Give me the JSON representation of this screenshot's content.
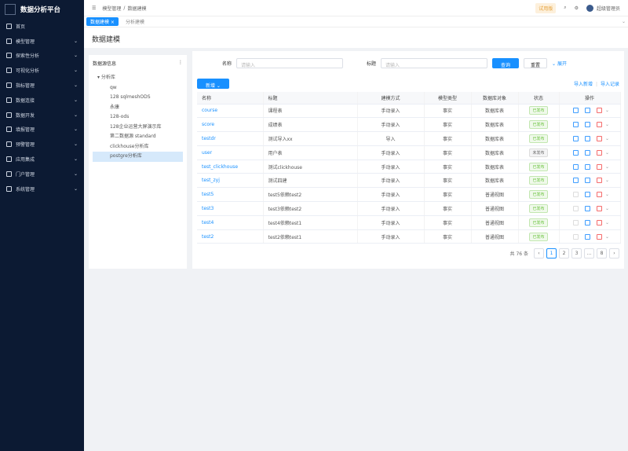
{
  "app": {
    "title": "数据分析平台"
  },
  "sidebar": {
    "items": [
      {
        "label": "首页",
        "icon": "home-icon",
        "expand": false
      },
      {
        "label": "模型管理",
        "icon": "bulb-icon",
        "expand": true
      },
      {
        "label": "探索性分析",
        "icon": "chart-icon",
        "expand": true
      },
      {
        "label": "可视化分析",
        "icon": "monitor-icon",
        "expand": true
      },
      {
        "label": "指标管理",
        "icon": "book-icon",
        "expand": true
      },
      {
        "label": "数据连接",
        "icon": "link-icon",
        "expand": true
      },
      {
        "label": "数据开发",
        "icon": "calendar-icon",
        "expand": true
      },
      {
        "label": "填报管理",
        "icon": "form-icon",
        "expand": true
      },
      {
        "label": "预警管理",
        "icon": "alert-icon",
        "expand": true
      },
      {
        "label": "应用集成",
        "icon": "app-icon",
        "expand": true
      },
      {
        "label": "门户管理",
        "icon": "portal-icon",
        "expand": true
      },
      {
        "label": "系统管理",
        "icon": "gear-icon",
        "expand": true
      }
    ]
  },
  "header": {
    "breadcrumb": [
      "模型管理",
      "数据建模"
    ],
    "trial": "试用版",
    "user": "超级管理员"
  },
  "tabs": [
    {
      "label": "数据建模 ×",
      "active": true
    },
    {
      "label": "分析建模",
      "active": false
    }
  ],
  "page_title": "数据建模",
  "tree": {
    "title": "数据源信息",
    "root": "分析库",
    "children": [
      "qw",
      "128 sqlmeshODS",
      "永康",
      "128-ods",
      "128企业运营大屏演示库",
      "第二数据源 standard",
      "clickhouse分析库",
      "postgre分析库"
    ],
    "selected": 7
  },
  "filters": {
    "name_label": "名称",
    "name_placeholder": "请输入",
    "title_label": "标题",
    "title_placeholder": "请输入",
    "search": "查询",
    "reset": "重置",
    "expand": "展开"
  },
  "toolbar": {
    "add": "新增 ⌄",
    "import_model": "导入新增",
    "import_record": "导入记录"
  },
  "table": {
    "headers": [
      "名称",
      "标题",
      "建模方式",
      "模型类型",
      "数据库对象",
      "状态",
      "操作"
    ],
    "rows": [
      [
        "course",
        "课程表",
        "手动录入",
        "事实",
        "数据库表",
        "已发布"
      ],
      [
        "score",
        "成绩表",
        "手动录入",
        "事实",
        "数据库表",
        "已发布"
      ],
      [
        "testdr",
        "测试导入xx",
        "导入",
        "事实",
        "数据库表",
        "已发布"
      ],
      [
        "user",
        "用户表",
        "手动录入",
        "事实",
        "数据库表",
        "未发布"
      ],
      [
        "test_clickhouse",
        "测试clickhouse",
        "手动录入",
        "事实",
        "数据库表",
        "已发布"
      ],
      [
        "test_zyj",
        "测试四建",
        "手动录入",
        "事实",
        "数据库表",
        "已发布"
      ],
      [
        "test5",
        "test5依赖test2",
        "手动录入",
        "事实",
        "普通视图",
        "已发布"
      ],
      [
        "test3",
        "test3依赖test2",
        "手动录入",
        "事实",
        "普通视图",
        "已发布"
      ],
      [
        "test4",
        "test4依赖test1",
        "手动录入",
        "事实",
        "普通视图",
        "已发布"
      ],
      [
        "test2",
        "test2依赖test1",
        "手动录入",
        "事实",
        "普通视图",
        "已发布"
      ]
    ]
  },
  "pagination": {
    "total": "共 76 条",
    "pages": [
      "1",
      "2",
      "3",
      "…",
      "8"
    ],
    "current": "1"
  }
}
